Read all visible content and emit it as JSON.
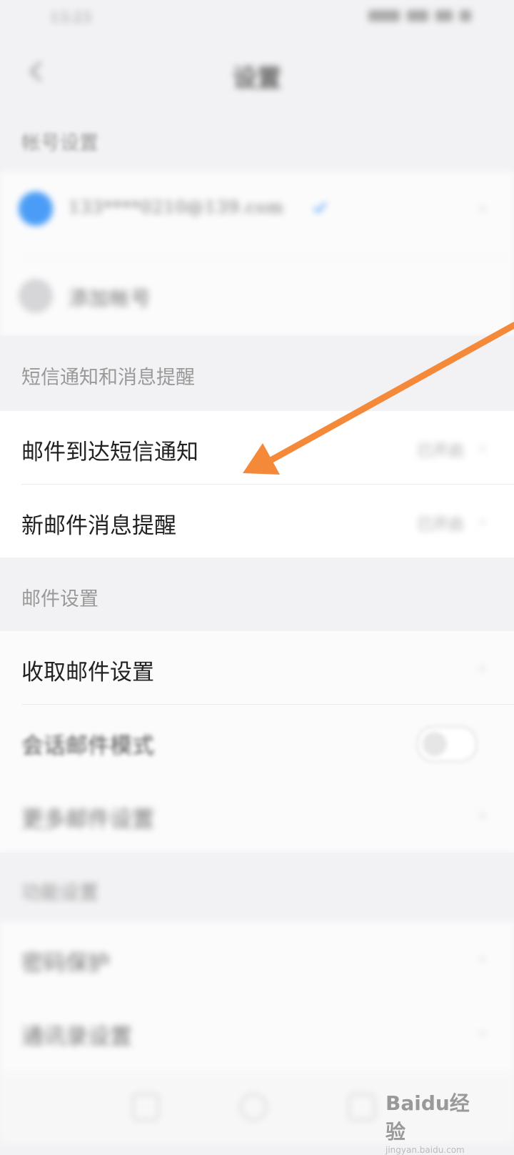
{
  "status_bar": {
    "time": "13:23"
  },
  "nav": {
    "title": "设置"
  },
  "sections": {
    "account": {
      "header": "帐号设置",
      "account_email": "133****0210@139.com",
      "add_account": "添加帐号"
    },
    "notify": {
      "header": "短信通知和消息提醒",
      "items": [
        {
          "label": "邮件到达短信通知",
          "value": "已开启"
        },
        {
          "label": "新邮件消息提醒",
          "value": "已开启"
        }
      ]
    },
    "mail": {
      "header": "邮件设置",
      "items": [
        {
          "label": "收取邮件设置"
        },
        {
          "label": "会话邮件模式"
        },
        {
          "label": "更多邮件设置"
        }
      ]
    },
    "other": {
      "header": "功能设置",
      "items": [
        {
          "label": "密码保护"
        },
        {
          "label": "通讯录设置"
        }
      ]
    }
  },
  "watermark": {
    "logo": "Baidu经验",
    "url": "jingyan.baidu.com"
  },
  "colors": {
    "arrow": "#f5893a",
    "avatar": "#4a9df6"
  }
}
